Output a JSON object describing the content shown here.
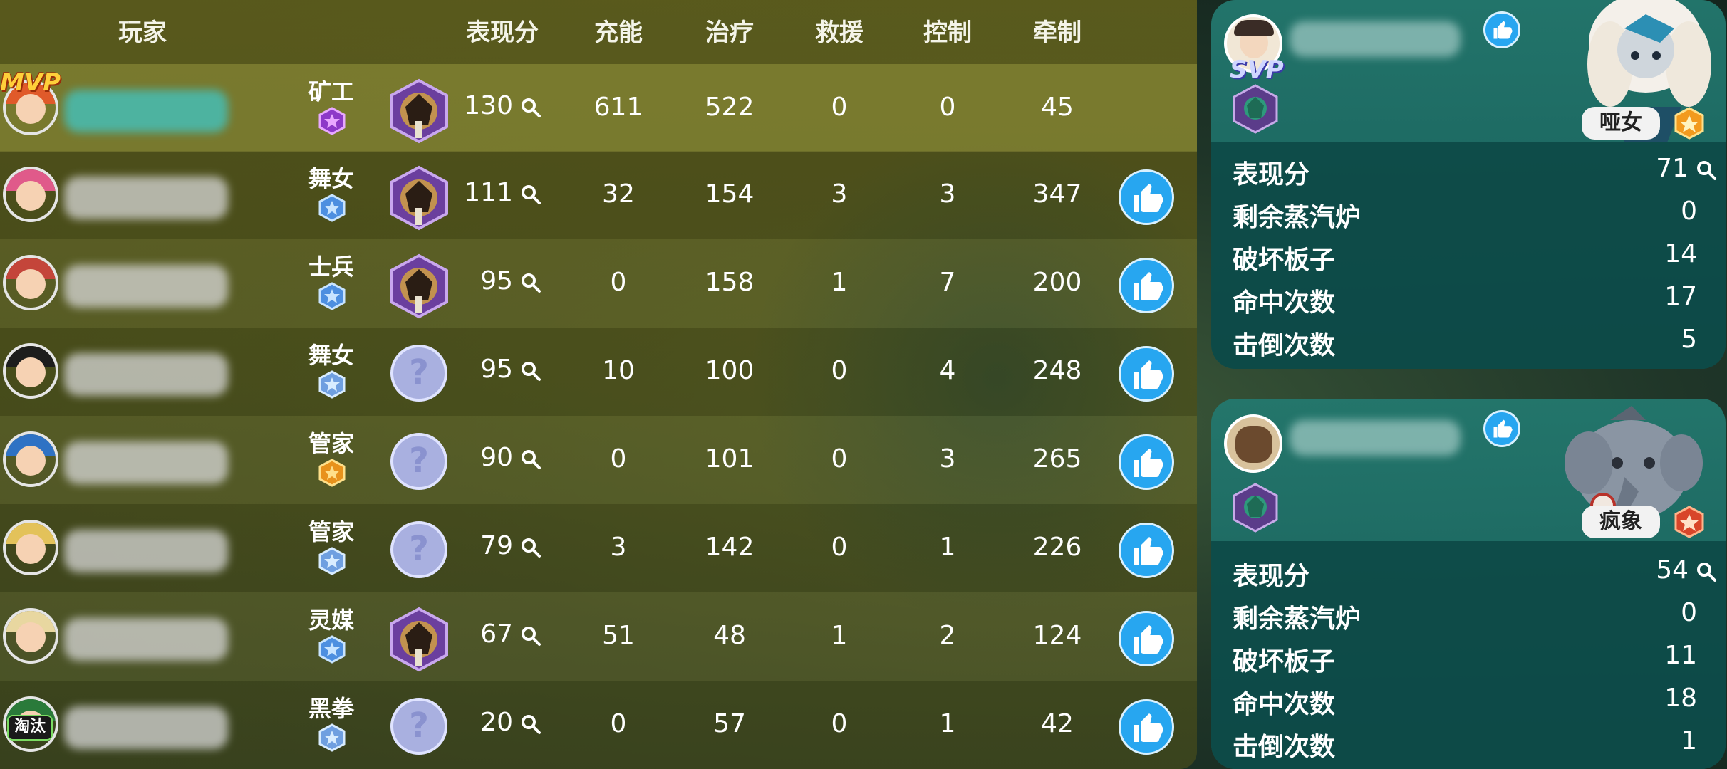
{
  "headers": {
    "player": "玩家",
    "score": "表现分",
    "charge": "充能",
    "heal": "治疗",
    "rescue": "救援",
    "control": "控制",
    "kite": "牵制"
  },
  "rows": [
    {
      "role": "矿工",
      "score": "130",
      "charge": "611",
      "heal": "522",
      "rescue": "0",
      "control": "0",
      "kite": "45",
      "tag": "MVP",
      "has_like": false,
      "portrait": "hexagon",
      "rank_icon": "purple-star-badge"
    },
    {
      "role": "舞女",
      "score": "111",
      "charge": "32",
      "heal": "154",
      "rescue": "3",
      "control": "3",
      "kite": "347",
      "has_like": true,
      "portrait": "hexagon",
      "rank_icon": "blue-star-badge"
    },
    {
      "role": "士兵",
      "score": "95",
      "charge": "0",
      "heal": "158",
      "rescue": "1",
      "control": "7",
      "kite": "200",
      "has_like": true,
      "portrait": "hexagon",
      "rank_icon": "blue-diamond-badge"
    },
    {
      "role": "舞女",
      "score": "95",
      "charge": "10",
      "heal": "100",
      "rescue": "0",
      "control": "4",
      "kite": "248",
      "has_like": true,
      "portrait": "question",
      "rank_icon": "light-blue-badge"
    },
    {
      "role": "管家",
      "score": "90",
      "charge": "0",
      "heal": "101",
      "rescue": "0",
      "control": "3",
      "kite": "265",
      "has_like": true,
      "portrait": "question",
      "rank_icon": "gold-badge"
    },
    {
      "role": "管家",
      "score": "79",
      "charge": "3",
      "heal": "142",
      "rescue": "0",
      "control": "1",
      "kite": "226",
      "has_like": true,
      "portrait": "question",
      "rank_icon": "light-blue-badge"
    },
    {
      "role": "灵媒",
      "score": "67",
      "charge": "51",
      "heal": "48",
      "rescue": "1",
      "control": "2",
      "kite": "124",
      "has_like": true,
      "portrait": "hexagon",
      "rank_icon": "blue-star-badge"
    },
    {
      "role": "黑拳",
      "score": "20",
      "charge": "0",
      "heal": "57",
      "rescue": "0",
      "control": "1",
      "kite": "42",
      "tag": "淘汰",
      "has_like": true,
      "portrait": "question",
      "rank_icon": "light-blue-badge"
    }
  ],
  "hunters": [
    {
      "tag": "SVP",
      "name": "哑女",
      "stats": [
        {
          "label": "表现分",
          "value": "71"
        },
        {
          "label": "剩余蒸汽炉",
          "value": "0"
        },
        {
          "label": "破坏板子",
          "value": "14"
        },
        {
          "label": "命中次数",
          "value": "17"
        },
        {
          "label": "击倒次数",
          "value": "5"
        }
      ]
    },
    {
      "name": "疯象",
      "stats": [
        {
          "label": "表现分",
          "value": "54"
        },
        {
          "label": "剩余蒸汽炉",
          "value": "0"
        },
        {
          "label": "破坏板子",
          "value": "11"
        },
        {
          "label": "命中次数",
          "value": "18"
        },
        {
          "label": "击倒次数",
          "value": "1"
        }
      ]
    }
  ],
  "colors": {
    "like": "#27a6f0",
    "table": "#62601c",
    "card": "#23786e"
  }
}
